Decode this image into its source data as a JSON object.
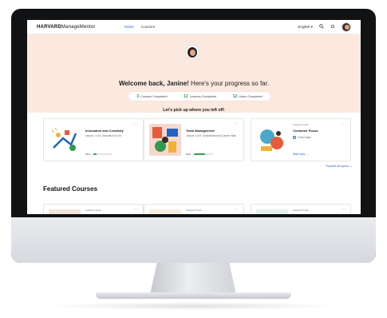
{
  "nav": {
    "logo_bold": "HARVARD",
    "logo_rest": "ManageMentor",
    "links": [
      "Home",
      "Courses"
    ],
    "language": "English ▾",
    "search_glyph": "⌕",
    "bell_glyph": "🔔"
  },
  "hero": {
    "welcome_bold": "Welcome back, Janine!",
    "welcome_rest": " Here's your progress so far.",
    "stats": [
      {
        "num": "3",
        "label": "Courses Completed"
      },
      {
        "num": "12",
        "label": "Lessons Completed"
      },
      {
        "num": "12",
        "label": "Hours Completed"
      }
    ],
    "pickup": "Let's pick up where you left off:"
  },
  "cards": [
    {
      "title": "Innovation and Creativity",
      "sub": "Lesson 1 of 6: Innovation for All",
      "pct": "15%",
      "progress": 0.15
    },
    {
      "title": "Team Management",
      "sub": "Lesson 3 of 5: Understand and Counter Bias",
      "pct": "60%",
      "progress": 0.6
    },
    {
      "tag": "Featured Topic",
      "title": "Customer Focus",
      "time": "2 hour topic",
      "start": "Start topic →"
    }
  ],
  "explore": "Explore all topics →",
  "featured": {
    "title": "Featured Courses",
    "tags": [
      "Featured Topic",
      "Featured Topic",
      "Featured Topic"
    ]
  },
  "colors": {
    "accent": "#1e63c4",
    "progress": "#2f9b4f",
    "hero_bg": "#fbe9e0"
  }
}
